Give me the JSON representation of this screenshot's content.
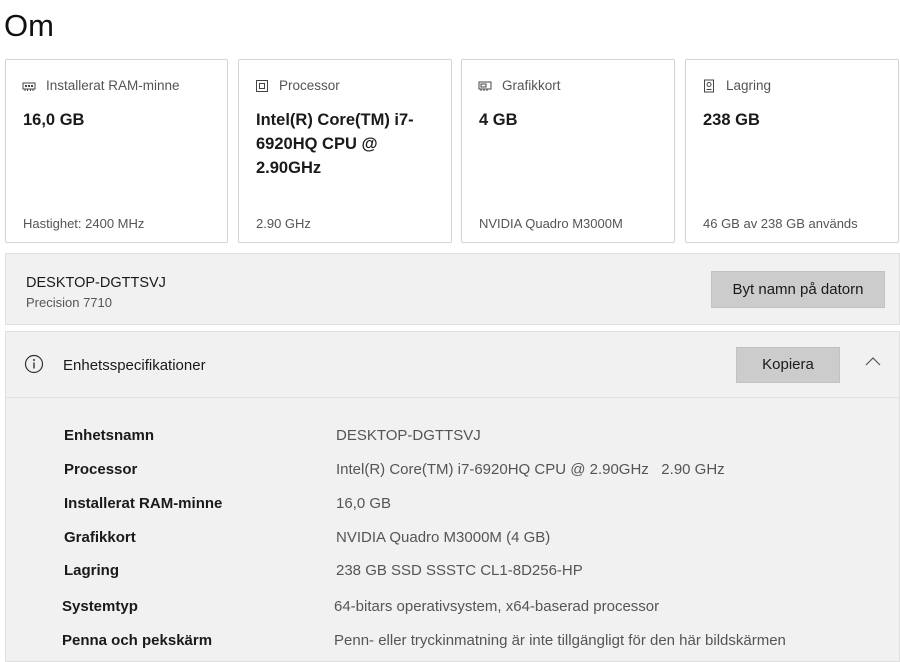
{
  "page": {
    "title": "Om"
  },
  "cards": [
    {
      "icon": "ram-icon",
      "label": "Installerat RAM-minne",
      "value": "16,0 GB",
      "sub": "Hastighet: 2400 MHz"
    },
    {
      "icon": "processor-icon",
      "label": "Processor",
      "value": "Intel(R) Core(TM) i7-6920HQ CPU @ 2.90GHz",
      "sub": "2.90 GHz"
    },
    {
      "icon": "graphics-card-icon",
      "label": "Grafikkort",
      "value": "4 GB",
      "sub": "NVIDIA Quadro M3000M"
    },
    {
      "icon": "storage-icon",
      "label": "Lagring",
      "value": "238 GB",
      "sub": "46 GB av 238 GB används"
    }
  ],
  "device": {
    "name": "DESKTOP-DGTTSVJ",
    "model": "Precision 7710",
    "rename_label": "Byt namn på datorn"
  },
  "specs": {
    "title": "Enhetsspecifikationer",
    "copy_label": "Kopiera",
    "rows": [
      {
        "label": "Enhetsnamn",
        "value": "DESKTOP-DGTTSVJ"
      },
      {
        "label": "Processor",
        "value": "Intel(R) Core(TM) i7-6920HQ CPU @ 2.90GHz   2.90 GHz"
      },
      {
        "label": "Installerat RAM-minne",
        "value": "16,0 GB"
      },
      {
        "label": "Grafikkort",
        "value": "NVIDIA Quadro M3000M (4 GB)"
      },
      {
        "label": "Lagring",
        "value": "238 GB SSD SSSTC CL1-8D256-HP"
      },
      {
        "label": "Systemtyp",
        "value": "64-bitars operativsystem, x64-baserad processor"
      },
      {
        "label": "Penna och pekskärm",
        "value": "Penn- eller tryckinmatning är inte tillgängligt för den här bildskärmen"
      }
    ]
  }
}
